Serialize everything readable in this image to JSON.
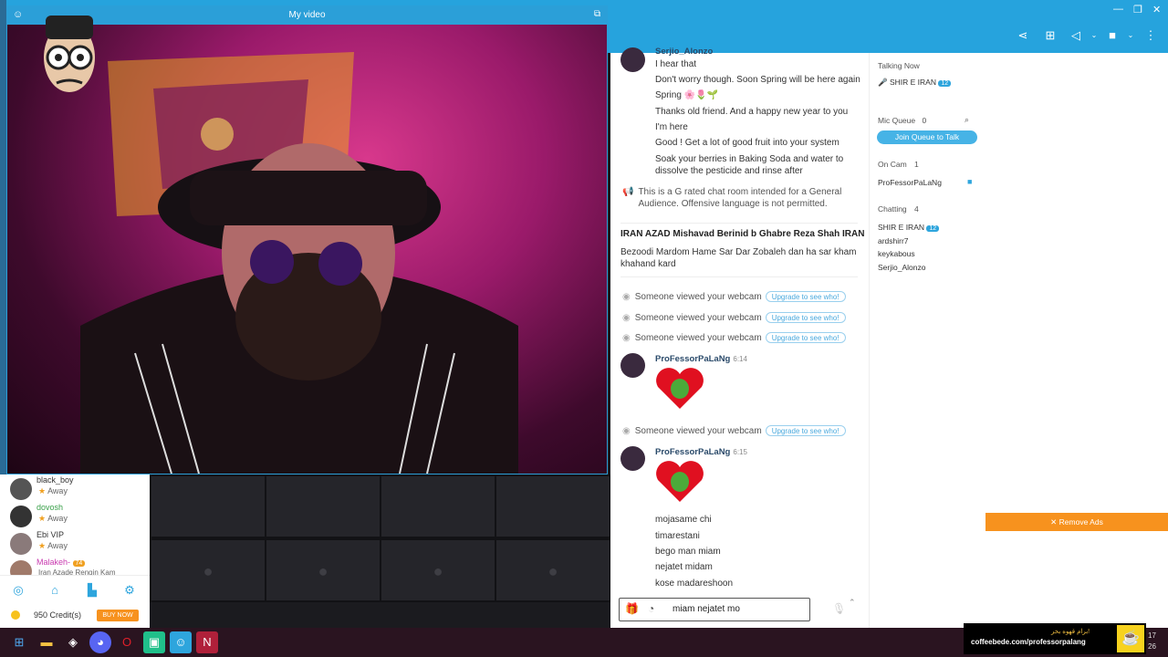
{
  "window": {
    "video_title": "My video"
  },
  "toolbar": {
    "icons": [
      "share-icon",
      "gift-icon",
      "megaphone-icon",
      "camera-icon",
      "more-icon"
    ]
  },
  "messages": {
    "partial_name": "Serjio_Alonzo",
    "lines1": [
      "I hear that",
      "Don't worry though. Soon Spring will be here again",
      "Spring 🌸🌷🌱",
      "Thanks old friend. And a happy new year to you",
      "I'm here",
      "Good ! Get a lot of good fruit into your system",
      "Soak your berries in Baking Soda and water to dissolve the pesticide and rinse after"
    ],
    "rules": "This is a G rated chat room intended for a General Audience. Offensive language is not permitted.",
    "topic_title": "IRAN AZAD Mishavad Berinid b Ghabre Reza Shah IRAN",
    "topic_body": "Bezoodi Mardom Hame Sar Dar Zobaleh dan ha sar kham khahand kard",
    "webcam_view": "Someone viewed your webcam",
    "upgrade": "Upgrade to see who!",
    "user1": "ProFessorPaLaNg",
    "time1": "6:14",
    "user2": "ProFessorPaLaNg",
    "time2": "6:15",
    "lines2": [
      "mojasame chi",
      "timarestani",
      "bego man miam",
      "nejatet midam",
      "kose madareshoon"
    ]
  },
  "input": {
    "value": "miam nejatet mo"
  },
  "side": {
    "talking_now": "Talking Now",
    "talker": "SHIR E IRAN",
    "badge": "12",
    "mic_queue": "Mic Queue",
    "mic_count": "0",
    "join_queue": "Join Queue to Talk",
    "on_cam": "On Cam",
    "on_cam_count": "1",
    "cam_user": "ProFessorPaLaNg",
    "chatting": "Chatting",
    "chatting_count": "4",
    "chatters": [
      "SHIR E IRAN",
      "ardshirr7",
      "keykabous",
      "Serjio_Alonzo"
    ]
  },
  "ad": {
    "remove": "✕ Remove Ads",
    "coffee_text": "coffeebede.com/professorpalang",
    "coffee_fa": "برام قهوه بخر!"
  },
  "users": [
    {
      "name": "black_boy",
      "status": "Away",
      "color": "#333"
    },
    {
      "name": "dovosh",
      "status": "Away",
      "color": "#3aa04a"
    },
    {
      "name": "Ebi VIP",
      "status": "Away",
      "color": "#333"
    },
    {
      "name": "Malakeh-",
      "status": "Iran Azade Rengin Kam",
      "color": "#c93ab0",
      "badge": "74"
    }
  ],
  "credits": {
    "label": "950 Credit(s)",
    "buy": "BUY NOW"
  },
  "taskbar": {
    "clock_top": "17",
    "clock_bottom": "26"
  }
}
